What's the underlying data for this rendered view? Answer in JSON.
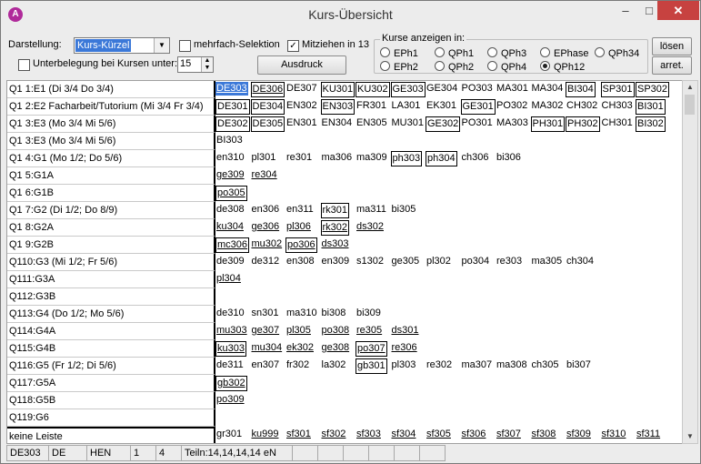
{
  "window": {
    "title": "Kurs-Übersicht",
    "icon": "app-icon",
    "icon_letter": "A",
    "min": "–",
    "max": "□",
    "close": "✕"
  },
  "controls": {
    "darstellung_label": "Darstellung:",
    "darstellung_value": "Kurs-Kürzel",
    "mehrfach_label": "mehrfach-Selektion",
    "mehrfach_checked": false,
    "mitzeihen_label": "Mitziehen in 13",
    "mitzeihen_checked": true,
    "unterbelegung_label": "Unterbelegung bei Kursen unter:",
    "unterbelegung_checked": false,
    "unterbelegung_value": "15",
    "ausdruck_button": "Ausdruck",
    "loesen_button": "lösen",
    "arret_button": "arret."
  },
  "kurse_anzeigen": {
    "title": "Kurse anzeigen in:",
    "options": [
      "EPh1",
      "QPh1",
      "QPh3",
      "EPhase",
      "QPh34",
      "EPh2",
      "QPh2",
      "QPh4",
      "QPh12"
    ],
    "selected": "QPh12"
  },
  "rows": [
    {
      "label": "Q1 1:E1  (Di 3/4 Do 3/4)",
      "cells": [
        {
          "t": "DE303",
          "s": "sel"
        },
        {
          "t": "DE306",
          "s": "boxu"
        },
        {
          "t": "DE307",
          "s": ""
        },
        {
          "t": "KU301",
          "s": "box"
        },
        {
          "t": "KU302",
          "s": "box"
        },
        {
          "t": "GE303",
          "s": "box"
        },
        {
          "t": "GE304",
          "s": ""
        },
        {
          "t": "PO303",
          "s": ""
        },
        {
          "t": "MA301",
          "s": ""
        },
        {
          "t": "MA304",
          "s": ""
        },
        {
          "t": "BI304",
          "s": "box"
        },
        {
          "t": "SP301",
          "s": "box"
        },
        {
          "t": "SP302",
          "s": "box"
        }
      ]
    },
    {
      "label": "Q1 2:E2 Facharbeit/Tutorium  (Mi 3/4 Fr 3/4)",
      "cells": [
        {
          "t": "DE301",
          "s": "box"
        },
        {
          "t": "DE304",
          "s": "box"
        },
        {
          "t": "EN302",
          "s": ""
        },
        {
          "t": "EN303",
          "s": "box"
        },
        {
          "t": "FR301",
          "s": ""
        },
        {
          "t": "LA301",
          "s": ""
        },
        {
          "t": "EK301",
          "s": ""
        },
        {
          "t": "GE301",
          "s": "box"
        },
        {
          "t": "PO302",
          "s": ""
        },
        {
          "t": "MA302",
          "s": ""
        },
        {
          "t": "CH302",
          "s": ""
        },
        {
          "t": "CH303",
          "s": ""
        },
        {
          "t": "BI301",
          "s": "box"
        }
      ]
    },
    {
      "label": "Q1 3:E3  (Mo 3/4 Mi 5/6)",
      "cells": [
        {
          "t": "DE302",
          "s": "box"
        },
        {
          "t": "DE305",
          "s": "box"
        },
        {
          "t": "EN301",
          "s": ""
        },
        {
          "t": "EN304",
          "s": ""
        },
        {
          "t": "EN305",
          "s": ""
        },
        {
          "t": "MU301",
          "s": ""
        },
        {
          "t": "GE302",
          "s": "box"
        },
        {
          "t": "PO301",
          "s": ""
        },
        {
          "t": "MA303",
          "s": ""
        },
        {
          "t": "PH301",
          "s": "box"
        },
        {
          "t": "PH302",
          "s": "box"
        },
        {
          "t": "CH301",
          "s": ""
        },
        {
          "t": "BI302",
          "s": "box"
        }
      ]
    },
    {
      "label": "Q1 3:E3  (Mo 3/4 Mi 5/6)",
      "cells": [
        {
          "t": "BI303",
          "s": ""
        }
      ]
    },
    {
      "label": "Q1 4:G1  (Mo 1/2;  Do 5/6)",
      "cells": [
        {
          "t": "en310",
          "s": ""
        },
        {
          "t": "pl301",
          "s": ""
        },
        {
          "t": "re301",
          "s": ""
        },
        {
          "t": "ma306",
          "s": ""
        },
        {
          "t": "ma309",
          "s": ""
        },
        {
          "t": "ph303",
          "s": "box"
        },
        {
          "t": "ph304",
          "s": "box"
        },
        {
          "t": "ch306",
          "s": ""
        },
        {
          "t": "bi306",
          "s": ""
        }
      ]
    },
    {
      "label": "Q1 5:G1A",
      "cells": [
        {
          "t": "ge309",
          "s": "under"
        },
        {
          "t": "re304",
          "s": "under"
        }
      ]
    },
    {
      "label": "Q1 6:G1B",
      "cells": [
        {
          "t": "po305",
          "s": "boxu"
        }
      ]
    },
    {
      "label": "Q1 7:G2  (Di 1/2; Do 8/9)",
      "cells": [
        {
          "t": "de308",
          "s": ""
        },
        {
          "t": "en306",
          "s": ""
        },
        {
          "t": "en311",
          "s": ""
        },
        {
          "t": "rk301",
          "s": "box"
        },
        {
          "t": "ma311",
          "s": ""
        },
        {
          "t": "bi305",
          "s": ""
        }
      ]
    },
    {
      "label": "Q1 8:G2A",
      "cells": [
        {
          "t": "ku304",
          "s": "under"
        },
        {
          "t": "ge306",
          "s": "under"
        },
        {
          "t": "pl306",
          "s": "under"
        },
        {
          "t": "rk302",
          "s": "boxu"
        },
        {
          "t": "ds302",
          "s": "under"
        }
      ]
    },
    {
      "label": "Q1 9:G2B",
      "cells": [
        {
          "t": "mc306",
          "s": "boxu"
        },
        {
          "t": "mu302",
          "s": "under"
        },
        {
          "t": "po306",
          "s": "boxu"
        },
        {
          "t": "ds303",
          "s": "under"
        }
      ]
    },
    {
      "label": "Q110:G3  (Mi 1/2; Fr 5/6)",
      "cells": [
        {
          "t": "de309",
          "s": ""
        },
        {
          "t": "de312",
          "s": ""
        },
        {
          "t": "en308",
          "s": ""
        },
        {
          "t": "en309",
          "s": ""
        },
        {
          "t": "s1302",
          "s": ""
        },
        {
          "t": "ge305",
          "s": ""
        },
        {
          "t": "pl302",
          "s": ""
        },
        {
          "t": "po304",
          "s": ""
        },
        {
          "t": "re303",
          "s": ""
        },
        {
          "t": "ma305",
          "s": ""
        },
        {
          "t": "ch304",
          "s": ""
        }
      ]
    },
    {
      "label": "Q111:G3A",
      "cells": [
        {
          "t": "pl304",
          "s": "under"
        }
      ]
    },
    {
      "label": "Q112:G3B",
      "cells": []
    },
    {
      "label": "Q113:G4  (Do 1/2; Mo 5/6)",
      "cells": [
        {
          "t": "de310",
          "s": ""
        },
        {
          "t": "sn301",
          "s": ""
        },
        {
          "t": "ma310",
          "s": ""
        },
        {
          "t": "bi308",
          "s": ""
        },
        {
          "t": "bi309",
          "s": ""
        }
      ]
    },
    {
      "label": "Q114:G4A",
      "cells": [
        {
          "t": "mu303",
          "s": "under"
        },
        {
          "t": "ge307",
          "s": "under"
        },
        {
          "t": "pl305",
          "s": "under"
        },
        {
          "t": "po308",
          "s": "under"
        },
        {
          "t": "re305",
          "s": "under"
        },
        {
          "t": "ds301",
          "s": "under"
        }
      ]
    },
    {
      "label": "Q115:G4B",
      "cells": [
        {
          "t": "ku303",
          "s": "boxu"
        },
        {
          "t": "mu304",
          "s": "under"
        },
        {
          "t": "ek302",
          "s": "under"
        },
        {
          "t": "ge308",
          "s": "under"
        },
        {
          "t": "po307",
          "s": "boxu"
        },
        {
          "t": "re306",
          "s": "under"
        }
      ]
    },
    {
      "label": "Q116:G5  (Fr 1/2; Di 5/6)",
      "cells": [
        {
          "t": "de311",
          "s": ""
        },
        {
          "t": "en307",
          "s": ""
        },
        {
          "t": "fr302",
          "s": ""
        },
        {
          "t": "la302",
          "s": ""
        },
        {
          "t": "gb301",
          "s": "box"
        },
        {
          "t": "pl303",
          "s": ""
        },
        {
          "t": "re302",
          "s": ""
        },
        {
          "t": "ma307",
          "s": ""
        },
        {
          "t": "ma308",
          "s": ""
        },
        {
          "t": "ch305",
          "s": ""
        },
        {
          "t": "bi307",
          "s": ""
        }
      ]
    },
    {
      "label": "Q117:G5A",
      "cells": [
        {
          "t": "gb302",
          "s": "boxu"
        }
      ]
    },
    {
      "label": "Q118:G5B",
      "cells": [
        {
          "t": "po309",
          "s": "under"
        }
      ]
    },
    {
      "label": "Q119:G6",
      "cells": []
    },
    {
      "label": "keine Leiste",
      "cells": [
        {
          "t": "gr301",
          "s": ""
        },
        {
          "t": "ku999",
          "s": "under"
        },
        {
          "t": "sf301",
          "s": "under"
        },
        {
          "t": "sf302",
          "s": "under"
        },
        {
          "t": "sf303",
          "s": "under"
        },
        {
          "t": "sf304",
          "s": "under"
        },
        {
          "t": "sf305",
          "s": "under"
        },
        {
          "t": "sf306",
          "s": "under"
        },
        {
          "t": "sf307",
          "s": "under"
        },
        {
          "t": "sf308",
          "s": "under"
        },
        {
          "t": "sf309",
          "s": "under"
        },
        {
          "t": "sf310",
          "s": "under"
        },
        {
          "t": "sf311",
          "s": "under"
        }
      ]
    }
  ],
  "status": [
    "DE303",
    "DE",
    "HEN",
    "1",
    "4",
    "Teiln:14,14,14,14 eN",
    "",
    "",
    "",
    "",
    "",
    ""
  ],
  "colors": {
    "selection": "#3b78d8",
    "close": "#c74240",
    "background": "#ececec"
  }
}
